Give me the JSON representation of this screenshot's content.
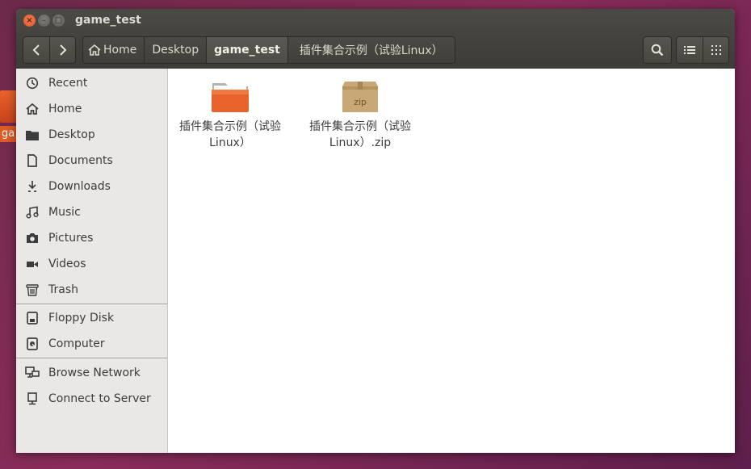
{
  "desktop": {
    "peek_label": "ga"
  },
  "window": {
    "title": "game_test",
    "controls": {
      "close": "×",
      "minimize": "–",
      "maximize": "□"
    }
  },
  "toolbar": {
    "back_icon": "chevron-left-icon",
    "forward_icon": "chevron-right-icon",
    "breadcrumbs": [
      {
        "label": "Home",
        "icon": "home-icon"
      },
      {
        "label": "Desktop"
      },
      {
        "label": "game_test",
        "active": true
      },
      {
        "label": "插件集合示例（试验Linux）"
      }
    ],
    "search_icon": "search-icon",
    "list_view_icon": "list-view-icon",
    "grid_view_icon": "grid-view-icon"
  },
  "sidebar": {
    "places": [
      {
        "label": "Recent",
        "icon": "clock-icon"
      },
      {
        "label": "Home",
        "icon": "home-icon"
      },
      {
        "label": "Desktop",
        "icon": "folder-icon"
      },
      {
        "label": "Documents",
        "icon": "document-icon"
      },
      {
        "label": "Downloads",
        "icon": "download-icon"
      },
      {
        "label": "Music",
        "icon": "music-icon"
      },
      {
        "label": "Pictures",
        "icon": "camera-icon"
      },
      {
        "label": "Videos",
        "icon": "video-icon"
      },
      {
        "label": "Trash",
        "icon": "trash-icon"
      }
    ],
    "devices": [
      {
        "label": "Floppy Disk",
        "icon": "floppy-icon"
      },
      {
        "label": "Computer",
        "icon": "computer-icon"
      }
    ],
    "network": [
      {
        "label": "Browse Network",
        "icon": "network-icon"
      },
      {
        "label": "Connect to Server",
        "icon": "server-icon"
      }
    ]
  },
  "files": [
    {
      "line1": "插件集合示例（试验",
      "line2": "Linux）",
      "type": "folder"
    },
    {
      "line1": "插件集合示例（试验",
      "line2": "Linux）.zip",
      "type": "zip",
      "badge": "zip"
    }
  ],
  "colors": {
    "accent": "#e95420",
    "titlebar": "#3c3b37"
  }
}
